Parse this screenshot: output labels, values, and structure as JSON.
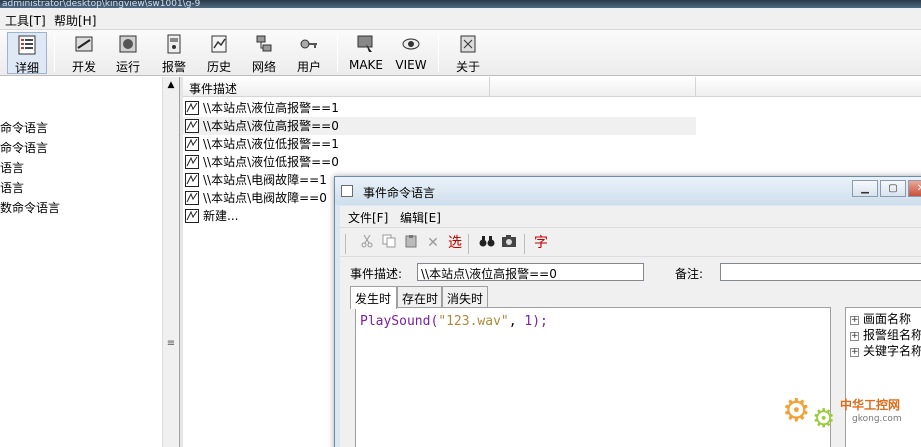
{
  "window": {
    "title_fragment": "administrator\\desktop\\kingview\\sw1001\\g-9"
  },
  "menubar": {
    "items": [
      "工具[T]",
      "帮助[H]"
    ]
  },
  "toolbar": {
    "buttons": [
      {
        "label": "详细",
        "icon": "details-icon",
        "selected": true
      },
      {
        "label": "开发",
        "icon": "develop-icon"
      },
      {
        "label": "运行",
        "icon": "run-icon"
      },
      {
        "label": "报警",
        "icon": "alarm-icon"
      },
      {
        "label": "历史",
        "icon": "history-icon"
      },
      {
        "label": "网络",
        "icon": "network-icon"
      },
      {
        "label": "用户",
        "icon": "user-key-icon"
      },
      {
        "label": "MAKE",
        "icon": "make-icon"
      },
      {
        "label": "VIEW",
        "icon": "view-icon"
      },
      {
        "label": "关于",
        "icon": "about-icon"
      }
    ]
  },
  "left_tree": {
    "items": [
      "命令语言",
      "命令语言",
      "语言",
      "语言",
      "数命令语言"
    ]
  },
  "event_list": {
    "columns": [
      "事件描述",
      "",
      ""
    ],
    "rows": [
      "\\\\本站点\\液位高报警==1",
      "\\\\本站点\\液位高报警==0",
      "\\\\本站点\\液位低报警==1",
      "\\\\本站点\\液位低报警==0",
      "\\\\本站点\\电阀故障==1",
      "\\\\本站点\\电阀故障==0",
      "新建..."
    ],
    "highlighted_index": 1
  },
  "dialog": {
    "title": "事件命令语言",
    "menu": [
      "文件[F]",
      "编辑[E]"
    ],
    "tools": {
      "cut_icon": "cut-icon",
      "copy_icon": "copy-icon",
      "paste_icon": "paste-icon",
      "delete_glyph": "✕",
      "select_label": "选",
      "find_icon": "binoculars-icon",
      "camera_icon": "camera-icon",
      "font_label": "字"
    },
    "event_desc_label": "事件描述:",
    "event_desc_value": "\\\\本站点\\液位高报警==0",
    "remark_label": "备注:",
    "remark_value": "",
    "tabs": [
      "发生时",
      "存在时",
      "消失时"
    ],
    "active_tab": 0,
    "code": {
      "fn": "PlaySound",
      "open": "(",
      "str": "\"123.wav\"",
      "sep": ", ",
      "num": "1",
      "close": ");"
    },
    "right_tree": [
      "画面名称",
      "报警组名称",
      "关键字名称"
    ]
  },
  "watermark": {
    "cn": "中华工控网",
    "url": "gkong.com"
  },
  "colors": {
    "code_function": "#7a1fa2",
    "code_string": "#b0893a",
    "highlight_row": "#f0f0f0"
  }
}
